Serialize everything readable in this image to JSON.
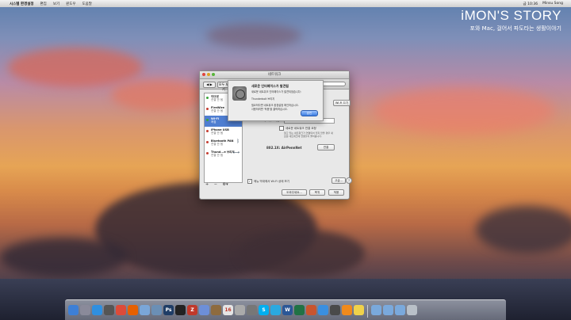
{
  "menubar": {
    "apple": "",
    "app_name": "시스템 환경설정",
    "menus": [
      "편집",
      "보기",
      "윈도우",
      "도움말"
    ],
    "right": [
      "금 10:36",
      "Minsu Song"
    ]
  },
  "brand": {
    "title": "iMON'S STORY",
    "subtitle": "포와 Mac, 걸어서 파도타는 생활이야기"
  },
  "window": {
    "title": "네트워크",
    "nav": "◀ ▶",
    "show_all": "모두 보기",
    "search_placeholder": "Q",
    "sheet": {
      "title": "새로운 인터페이스가 발견됨",
      "line1": "새로운 네트워크 인터페이스가 발견되었습니다:",
      "line2": "Thunderbolt 브리지",
      "line3": "필요하다면 네트워크 환경설정 확인하십시오.",
      "line4": "사용하려면 '적용'을 클릭하십시오.",
      "ok": "승인"
    },
    "services": [
      {
        "name": "이더넷",
        "status": "연결 안 됨",
        "dot": "#3aa53a",
        "icon": ""
      },
      {
        "name": "FireWire",
        "status": "연결 안 됨",
        "dot": "#c53b2f",
        "icon": ""
      },
      {
        "name": "Wi-Fi",
        "status": "켜짐",
        "dot": "#3aa53a",
        "icon": ""
      },
      {
        "name": "iPhone USB",
        "status": "연결 안 됨",
        "dot": "#c53b2f",
        "icon": ""
      },
      {
        "name": "Bluetooth PAN",
        "status": "연결 안 됨",
        "dot": "#c53b2f",
        "icon": "ᛒ"
      },
      {
        "name": "Thund...e 브리지",
        "status": "연결 안 됨",
        "dot": "#c53b2f",
        "icon": "⟷"
      }
    ],
    "tools": [
      "+",
      "−",
      "⚙▾"
    ],
    "pane": {
      "turn_off": "Wi-Fi 끄기",
      "network_name_label": "네트워크 이름:",
      "network_name_value": "",
      "ask_join_label": "새로운 네트워크 연결 요청",
      "ask_join_desc": "알고 있는 네트워크가 연결되어 있지 않을 경우 새로운 네트워크에 연결할지 물어봅니다.",
      "address": "802.1X: AirPennNet",
      "connect": "연결",
      "menu_bar_checkbox": "메뉴 막대에서 Wi-Fi 상태 보기",
      "advanced": "고급...",
      "help": "?",
      "assist": "도와주세요...",
      "revert": "복귀",
      "apply": "적용"
    }
  },
  "dock": {
    "icons": [
      {
        "name": "finder-icon",
        "label": "",
        "color": "#3d7fd6"
      },
      {
        "name": "launchpad-icon",
        "label": "",
        "color": "#8a8a9a"
      },
      {
        "name": "safari-icon",
        "label": "",
        "color": "#2f8fe0"
      },
      {
        "name": "mission-control-icon",
        "label": "",
        "color": "#555"
      },
      {
        "name": "chrome-icon",
        "label": "",
        "color": "#dd4b39"
      },
      {
        "name": "firefox-icon",
        "label": "",
        "color": "#e66000"
      },
      {
        "name": "mail-icon",
        "label": "",
        "color": "#7aa6d8"
      },
      {
        "name": "preview-icon",
        "label": "",
        "color": "#6b8fb5"
      },
      {
        "name": "photoshop-icon",
        "label": "Ps",
        "color": "#1f3d66"
      },
      {
        "name": "terminal-icon",
        "label": "",
        "color": "#222"
      },
      {
        "name": "filezilla-icon",
        "label": "Z",
        "color": "#c0392b"
      },
      {
        "name": "itunes-icon",
        "label": "",
        "color": "#6d8fd8"
      },
      {
        "name": "address-book-icon",
        "label": "",
        "color": "#8e6b3e"
      },
      {
        "name": "calendar-icon",
        "label": "16",
        "color": "#e5e5e5"
      },
      {
        "name": "textedit-icon",
        "label": "",
        "color": "#aaa"
      },
      {
        "name": "system-preferences-icon",
        "label": "",
        "color": "#777"
      },
      {
        "name": "skype-icon",
        "label": "S",
        "color": "#00aff0"
      },
      {
        "name": "twitter-icon",
        "label": "",
        "color": "#2aa9e0"
      },
      {
        "name": "word-icon",
        "label": "W",
        "color": "#2b5797"
      },
      {
        "name": "excel-icon",
        "label": "",
        "color": "#207245"
      },
      {
        "name": "powerpoint-icon",
        "label": "",
        "color": "#c9552f"
      },
      {
        "name": "app-store-icon",
        "label": "",
        "color": "#3a8fe0"
      },
      {
        "name": "activity-icon",
        "label": "",
        "color": "#4a4a4a"
      },
      {
        "name": "vlc-icon",
        "label": "",
        "color": "#f08a1c"
      },
      {
        "name": "stickies-icon",
        "label": "",
        "color": "#f0d24a"
      }
    ],
    "stacks": [
      {
        "name": "applications-folder-icon",
        "color": "#7aa9dc"
      },
      {
        "name": "documents-folder-icon",
        "color": "#7aa9dc"
      },
      {
        "name": "downloads-folder-icon",
        "color": "#7aa9dc"
      },
      {
        "name": "trash-icon",
        "color": "#b9c0c8"
      }
    ]
  },
  "colors": {
    "selection": "#4f7ed1",
    "ok_button": "#3a7be0"
  }
}
